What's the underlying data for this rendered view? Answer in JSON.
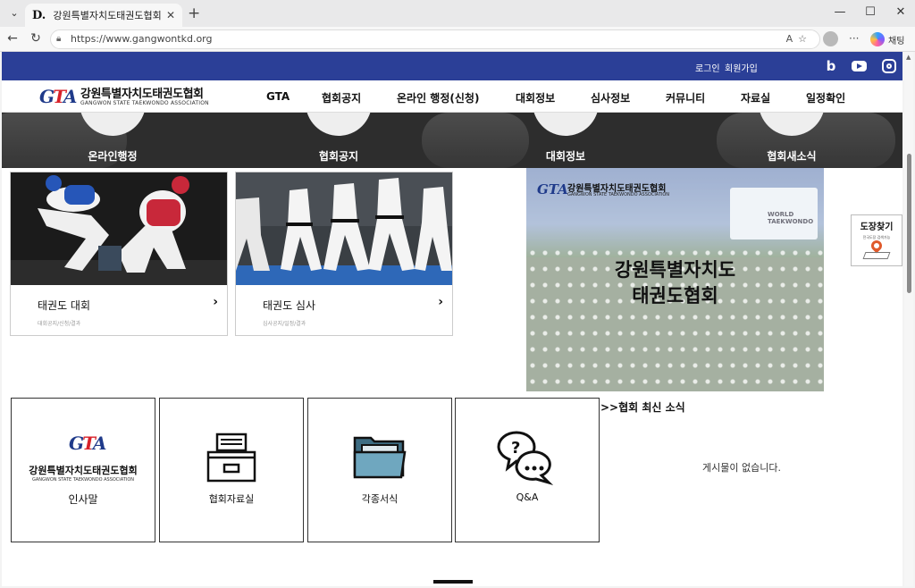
{
  "browser": {
    "tab_title": "강원특별자치도태권도협회",
    "tab_favicon": "D.",
    "url": "https://www.gangwontkd.org",
    "copilot_label": "채팅"
  },
  "site": {
    "top_links": [
      "로그인",
      "회원가입"
    ],
    "logo_korean": "강원특별자치도태권도협회",
    "logo_english": "GANGWON STATE TAEKWONDO ASSOCIATION",
    "menu": [
      "GTA",
      "협회공지",
      "온라인 행정(신청)",
      "대회정보",
      "심사정보",
      "커뮤니티",
      "자료실",
      "일정확인"
    ],
    "hero_items": [
      "온라인행정",
      "협회공지",
      "대회정보",
      "협회새소식"
    ],
    "cards": [
      {
        "title": "태권도 대회",
        "sub": "대회공지/신청/결과"
      },
      {
        "title": "태권도 심사",
        "sub": "심사공지/일정/결과"
      }
    ],
    "poster": {
      "logo_korean": "강원특별자치도태권도협회",
      "logo_english": "GANGWON STATE TAEKWONDO ASSOCIATION",
      "headline_1": "강원특별자치도",
      "headline_2": "태권도협회",
      "banner": "WORLD TAEKWONDO"
    },
    "find_dojang": {
      "title": "도장찾기",
      "sub": "전국도장 검색가능"
    },
    "quick_links": [
      "인사말",
      "협회자료실",
      "각종서식",
      "Q&A"
    ],
    "news_title": ">>협회 최신 소식",
    "news_empty": "게시물이 없습니다."
  }
}
